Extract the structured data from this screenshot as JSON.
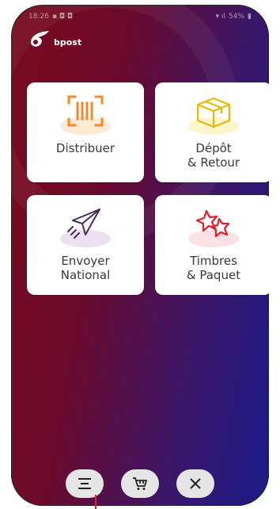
{
  "status_bar": {
    "time": "18:26",
    "battery": "54%"
  },
  "brand": {
    "name": "bpost"
  },
  "tiles": [
    {
      "id": "distribuer",
      "label": "Distribuer",
      "icon": "barcode-scanner-icon",
      "accent": "#f08a2a"
    },
    {
      "id": "depot",
      "label": "Dépôt\n& Retour",
      "icon": "parcel-box-icon",
      "accent": "#f0c000"
    },
    {
      "id": "envoyer",
      "label": "Envoyer\nNational",
      "icon": "paper-plane-icon",
      "accent": "#5a2a6a"
    },
    {
      "id": "timbres",
      "label": "Timbres\n& Paquet",
      "icon": "stamp-stars-icon",
      "accent": "#e0202a"
    }
  ],
  "bottom_bar": [
    {
      "id": "menu",
      "icon": "menu-icon"
    },
    {
      "id": "cart",
      "icon": "cart-icon"
    },
    {
      "id": "close",
      "icon": "close-icon"
    }
  ],
  "colors": {
    "gradient_start": "#7a0a1c",
    "gradient_end": "#1a1a8a",
    "card_bg": "#ffffff"
  }
}
